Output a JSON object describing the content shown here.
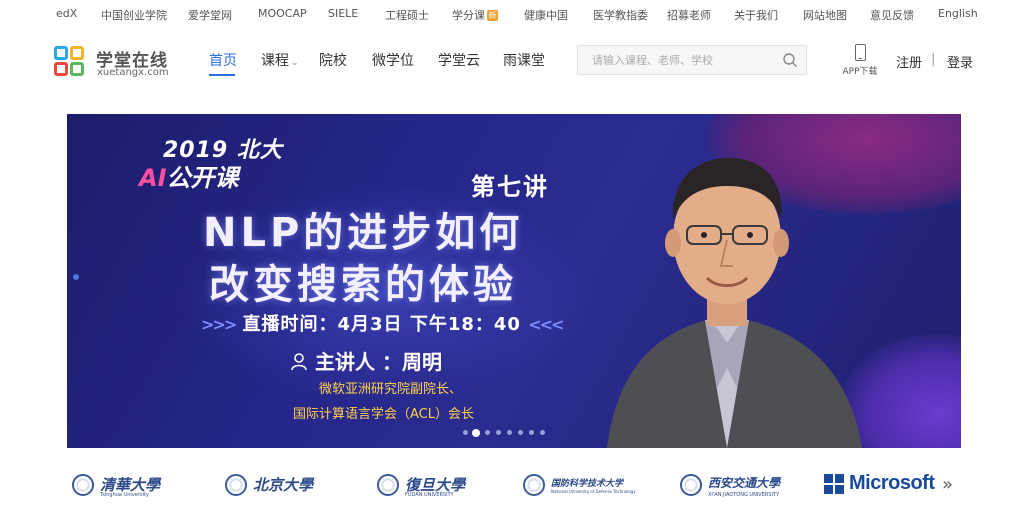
{
  "topbar": {
    "links": [
      {
        "label": "edX"
      },
      {
        "label": "中国创业学院"
      },
      {
        "label": "爱学堂网"
      },
      {
        "label": "MOOCAP"
      },
      {
        "label": "SIELE"
      },
      {
        "label": "工程硕士"
      },
      {
        "label": "学分课",
        "badge": "新"
      },
      {
        "label": "健康中国"
      },
      {
        "label": "医学教指委"
      },
      {
        "label": "招募老师"
      },
      {
        "label": "关于我们"
      },
      {
        "label": "网站地图"
      },
      {
        "label": "意见反馈"
      },
      {
        "label": "English"
      }
    ]
  },
  "header": {
    "logo_cn": "学堂在线",
    "logo_en": "xuetangx.com",
    "nav": [
      {
        "label": "首页",
        "active": true
      },
      {
        "label": "课程"
      },
      {
        "label": "院校"
      },
      {
        "label": "微学位"
      },
      {
        "label": "学堂云"
      },
      {
        "label": "雨课堂"
      }
    ],
    "search_placeholder": "请输入课程、老师、学校",
    "app_label": "APP下载",
    "register": "注册",
    "separator": "|",
    "login": "登录"
  },
  "banner": {
    "year_line": "2019 北大",
    "ai_tag": "AI",
    "ai_rest": "公开课",
    "lecture": "第七讲",
    "title_line1": "NLP的进步如何",
    "title_line2": "改变搜索的体验",
    "time_arrows_left": ">>>",
    "time_text": "直播时间：4月3日 下午18：40",
    "time_arrows_right": "<<<",
    "speaker": "主讲人 ：周明",
    "role_line1": "微软亚洲研究院副院长、",
    "role_line2": "国际计算语言学会（ACL）会长",
    "slide_count": 8,
    "active_slide": 2
  },
  "partners": [
    {
      "name": "清華大學",
      "sub": "Tsinghua University"
    },
    {
      "name": "北京大學",
      "sub": ""
    },
    {
      "name": "復旦大學",
      "sub": "FUDAN UNIVERSITY"
    },
    {
      "name": "国防科学技术大学",
      "sub": "National University of Defense Technology"
    },
    {
      "name": "西安交通大學",
      "sub": "XI'AN JIAOTONG UNIVERSITY"
    }
  ],
  "microsoft": "Microsoft",
  "more_arrow": "»",
  "colors": {
    "accent": "#2a6fe0",
    "banner_bg": "#26268a",
    "highlight_yellow": "#ffd24a",
    "ai_pink": "#ff4fa0",
    "partner_blue": "#2c4a8a"
  }
}
